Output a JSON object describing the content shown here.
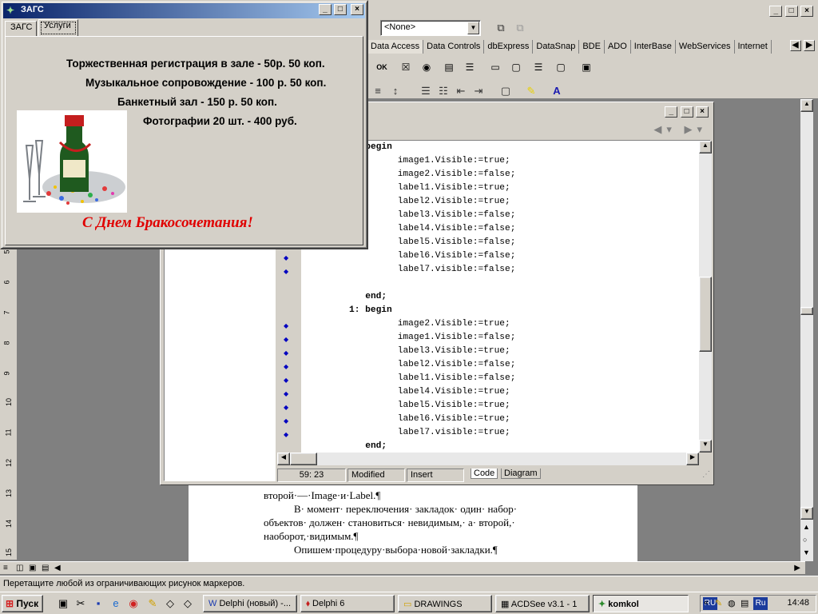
{
  "ide_main": {
    "component_combo_value": "<None>",
    "palette_tabs": [
      "Data Access",
      "Data Controls",
      "dbExpress",
      "DataSnap",
      "BDE",
      "ADO",
      "InterBase",
      "WebServices",
      "Internet"
    ],
    "palette_items": [
      "OK",
      "☒",
      "◉",
      "▤",
      "☰",
      "▭",
      "▢",
      "☰",
      "▢",
      "▣"
    ]
  },
  "code_editor": {
    "lines": [
      {
        "text": "begin",
        "bold": true,
        "indent": 11
      },
      {
        "text": "image1.Visible:=true;",
        "bold": false,
        "indent": 17
      },
      {
        "text": "image2.Visible:=false;",
        "bold": false,
        "indent": 17
      },
      {
        "text": "label1.Visible:=true;",
        "bold": false,
        "indent": 17
      },
      {
        "text": "label2.Visible:=true;",
        "bold": false,
        "indent": 17
      },
      {
        "text": "label3.Visible:=false;",
        "bold": false,
        "indent": 17
      },
      {
        "text": "label4.Visible:=false;",
        "bold": false,
        "indent": 17
      },
      {
        "text": "label5.Visible:=false;",
        "bold": false,
        "indent": 17
      },
      {
        "text": "label6.Visible:=false;",
        "bold": false,
        "indent": 17
      },
      {
        "text": "label7.visible:=false;",
        "bold": false,
        "indent": 17
      },
      {
        "text": "",
        "bold": false,
        "indent": 0
      },
      {
        "text": "end;",
        "bold": true,
        "indent": 11
      },
      {
        "text": "1: begin",
        "bold": true,
        "indent": 8
      },
      {
        "text": "image2.Visible:=true;",
        "bold": false,
        "indent": 17
      },
      {
        "text": "image1.Visible:=false;",
        "bold": false,
        "indent": 17
      },
      {
        "text": "label3.Visible:=true;",
        "bold": false,
        "indent": 17
      },
      {
        "text": "label2.Visible:=false;",
        "bold": false,
        "indent": 17
      },
      {
        "text": "label1.Visible:=false;",
        "bold": false,
        "indent": 17
      },
      {
        "text": "label4.Visible:=true;",
        "bold": false,
        "indent": 17
      },
      {
        "text": "label5.Visible:=true;",
        "bold": false,
        "indent": 17
      },
      {
        "text": "label6.Visible:=true;",
        "bold": false,
        "indent": 17
      },
      {
        "text": "label7.visible:=true;",
        "bold": false,
        "indent": 17
      },
      {
        "text": "end;",
        "bold": true,
        "indent": 11
      }
    ],
    "status": {
      "position": "59: 23",
      "state": "Modified",
      "mode": "Insert",
      "tab_code": "Code",
      "tab_diagram": "Diagram"
    }
  },
  "zags": {
    "title": "ЗАГС",
    "tabs": [
      "ЗАГС",
      "Услуги"
    ],
    "services": [
      "Торжественная регистрация в зале - 50р. 50 коп.",
      "Музыкальное сопровождение - 100 р. 50 коп.",
      "Банкетный зал - 150 р. 50 коп.",
      "Фотографии 20 шт. - 400 руб."
    ],
    "congrats": "С Днем Бракосочетания!"
  },
  "word": {
    "ruler_numbers": [
      "5",
      "6",
      "7",
      "8",
      "9",
      "10",
      "11",
      "12",
      "13",
      "14",
      "15"
    ],
    "doc_lines": [
      "второй·—·Image·и·Label.¶",
      "В· момент· переключения· закладок· один· набор·",
      "объектов· должен· становиться· невидимым,· а· второй,·",
      "наоборот,·видимым.¶",
      "Опишем·процедуру·выбора·новой·закладки.¶"
    ],
    "status_text": "Перетащите любой из ограничивающих рисунок маркеров."
  },
  "taskbar": {
    "start_label": "Пуск",
    "tasks": [
      "Delphi (новый) -...",
      "Delphi 6",
      "DRAWINGS",
      "ACDSee v3.1 - 1",
      "komkol"
    ],
    "lang": "RU",
    "tray_lang": "Ru",
    "clock": "14:48"
  }
}
